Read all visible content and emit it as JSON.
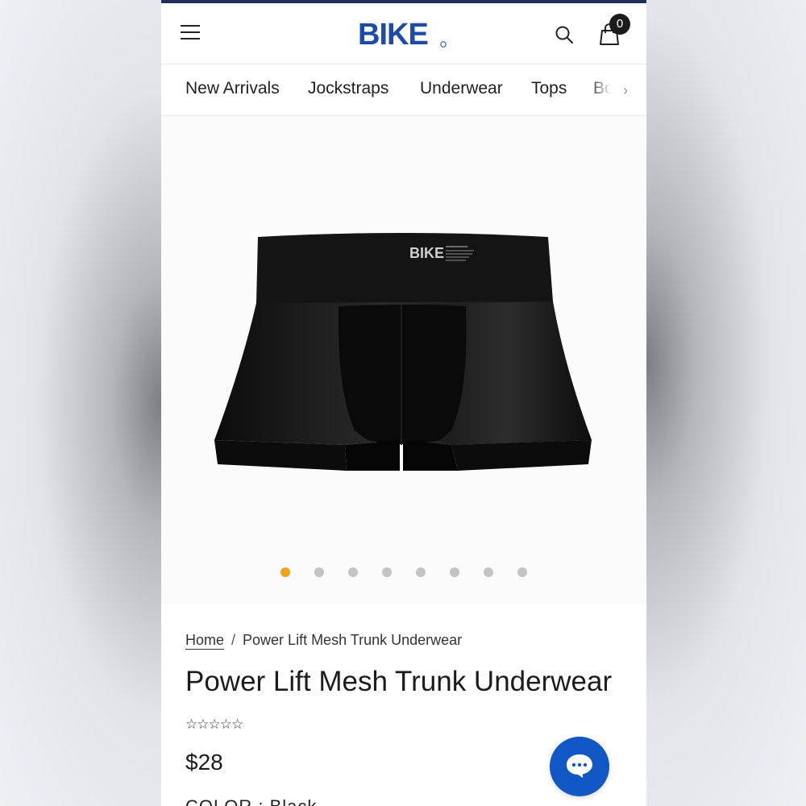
{
  "header": {
    "brand": "BIKE",
    "cart_count": "0",
    "icons": [
      "menu-icon",
      "search-icon",
      "cart-icon"
    ]
  },
  "nav": {
    "items": [
      "New Arrivals",
      "Jockstraps",
      "Underwear",
      "Tops",
      "Bo"
    ]
  },
  "gallery": {
    "image_count": 8,
    "active_index": 0,
    "waistband_logo": "BIKE"
  },
  "breadcrumb": {
    "home": "Home",
    "separator": "/",
    "current": "Power Lift Mesh Trunk Underwear"
  },
  "product": {
    "title": "Power Lift Mesh Trunk Underwear",
    "rating_stars": "☆☆☆☆☆",
    "price": "$28",
    "partial_line": "COLOR : Black"
  },
  "chat": {
    "icon": "chat-bubble-icon"
  },
  "colors": {
    "brand_blue": "#1E4AA8",
    "topline": "#1f2f5c",
    "active_dot": "#f0a21b",
    "chat_button": "#1157c5"
  }
}
